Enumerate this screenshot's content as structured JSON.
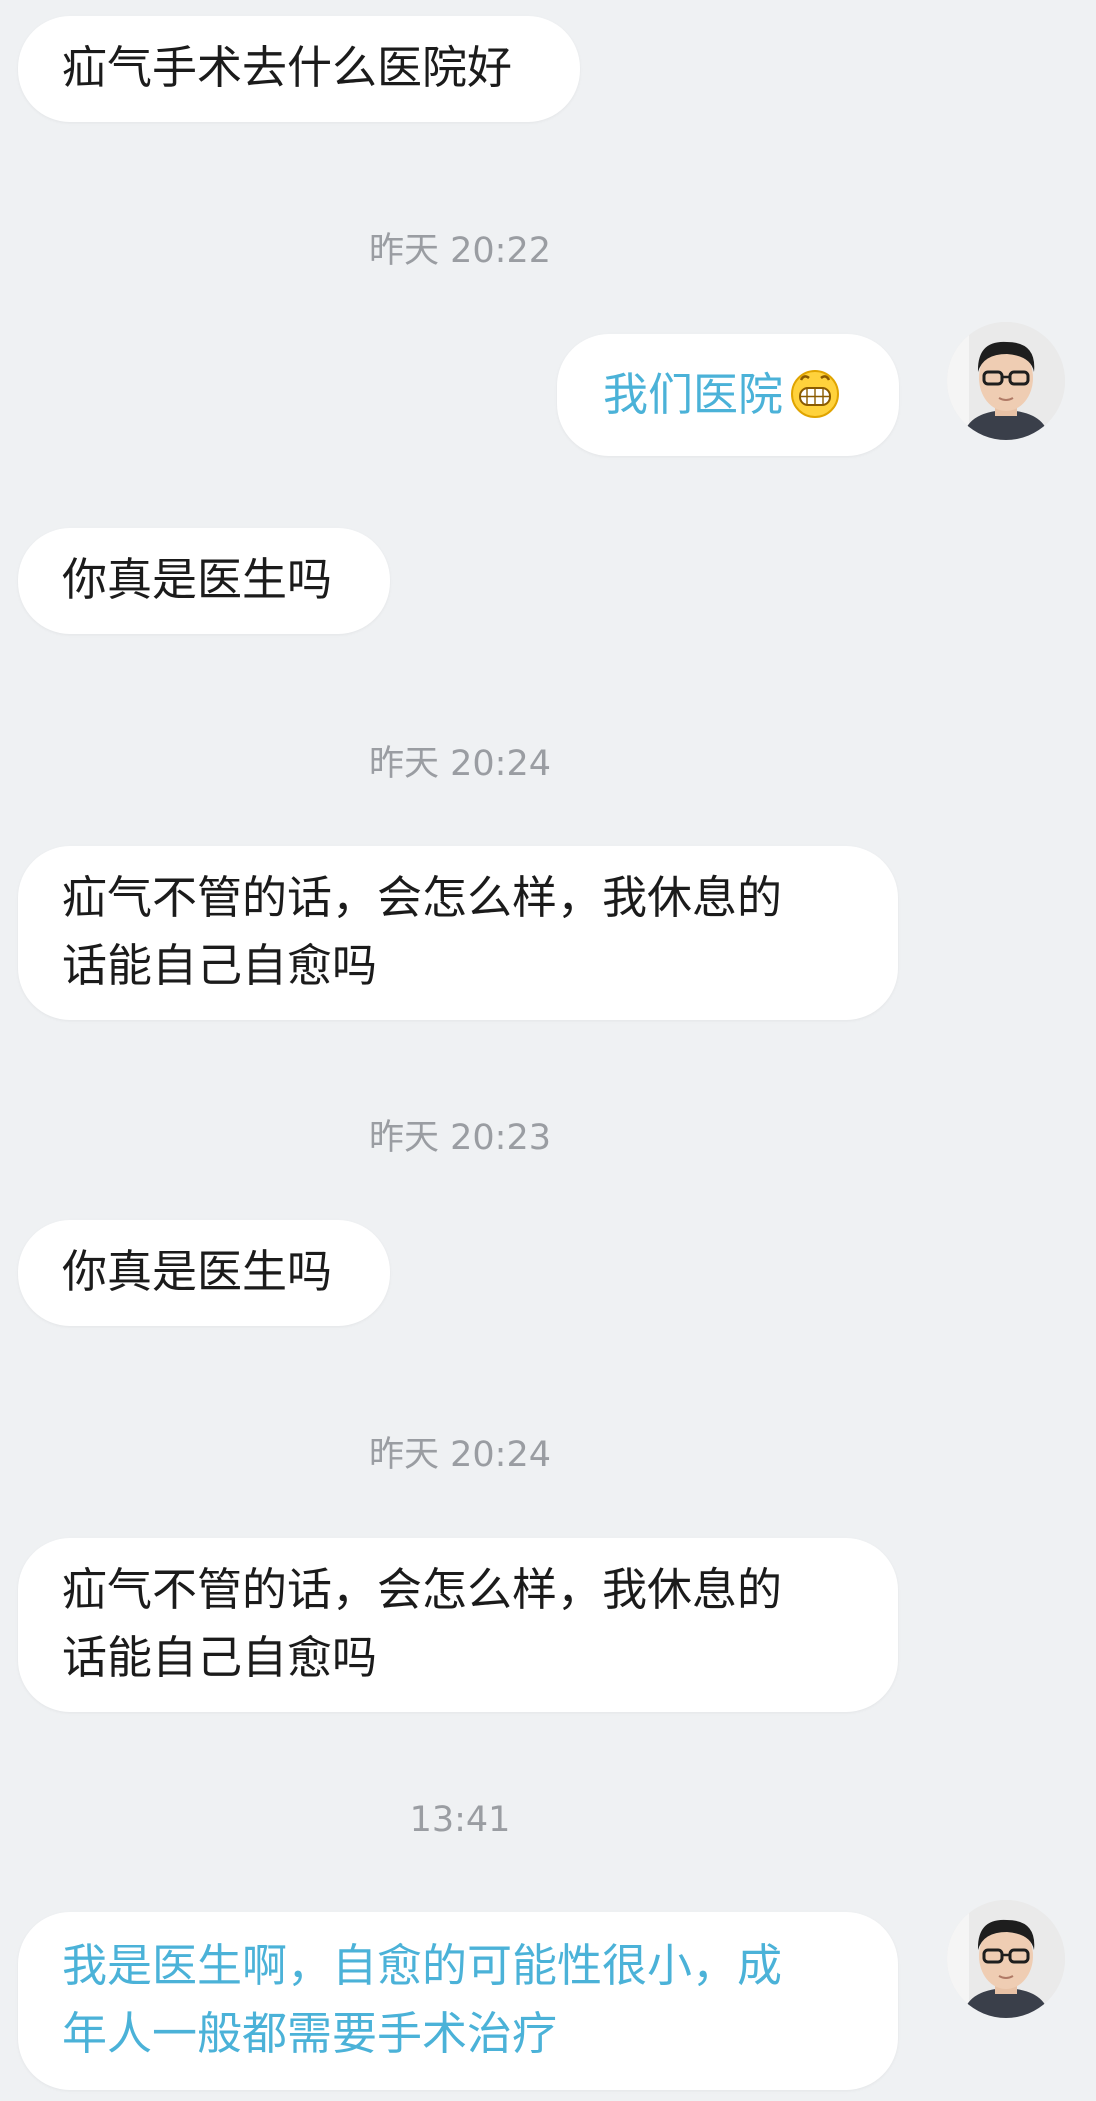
{
  "messages": [
    {
      "text": "疝气手术去什么医院好"
    },
    {
      "time": "昨天 20:22"
    },
    {
      "text": "我们医院"
    },
    {
      "text": "你真是医生吗"
    },
    {
      "time": "昨天 20:24"
    },
    {
      "text": "疝气不管的话，会怎么样，我休息的\n话能自己自愈吗"
    },
    {
      "time": "昨天 20:23"
    },
    {
      "text": "你真是医生吗"
    },
    {
      "time": "昨天 20:24"
    },
    {
      "text": "疝气不管的话，会怎么样，我休息的\n话能自己自愈吗"
    },
    {
      "time": "13:41"
    },
    {
      "text": "我是医生啊，自愈的可能性很小，成\n年人一般都需要手术治疗"
    }
  ],
  "icons": {
    "grin_emoji": "grinning-face-icon",
    "doctor_avatar": "doctor-avatar"
  },
  "colors": {
    "background": "#eff1f3",
    "bubble": "#ffffff",
    "doctor_text": "#4bb2d8",
    "patient_text": "#1b1b1b",
    "timestamp": "#9a9da2"
  }
}
